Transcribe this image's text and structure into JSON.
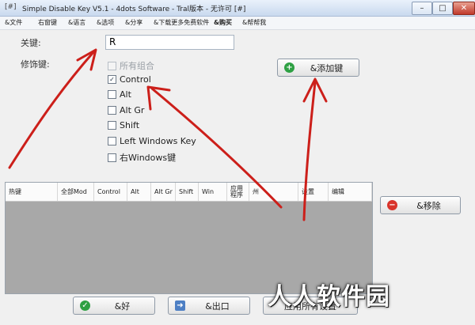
{
  "window": {
    "icon_text": "[#]",
    "title": "Simple Disable Key V5.1 - 4dots Software - Tral版本 - 无许可 [#]",
    "controls": [
      "–",
      "□",
      "✕"
    ]
  },
  "menu": [
    "&文件",
    "右窗键",
    "&语言",
    "&选项",
    "&分享",
    "&下载更多免费软件",
    "&购买",
    "&帮帮我"
  ],
  "form": {
    "key_label": "关键:",
    "key_value": "R",
    "modifier_label": "修饰键:",
    "modifiers": [
      {
        "label": "所有组合",
        "checked": false,
        "disabled": true
      },
      {
        "label": "Control",
        "checked": true,
        "disabled": false
      },
      {
        "label": "Alt",
        "checked": false,
        "disabled": false
      },
      {
        "label": "Alt Gr",
        "checked": false,
        "disabled": false
      },
      {
        "label": "Shift",
        "checked": false,
        "disabled": false
      },
      {
        "label": "Left Windows Key",
        "checked": false,
        "disabled": false
      },
      {
        "label": "右Windows键",
        "checked": false,
        "disabled": false
      }
    ]
  },
  "buttons": {
    "add": "&添加键",
    "remove": "&移除",
    "ok": "&好",
    "exit": "&出口",
    "apply": "应用所有设置"
  },
  "table": {
    "columns": [
      "热键",
      "全部Mod",
      "Control",
      "Alt",
      "Alt Gr",
      "Shift",
      "Win",
      "应用程序",
      "州",
      "设置",
      "编辑"
    ]
  },
  "watermark": "人人软件园",
  "colors": {
    "accent_red": "#cc1f1a",
    "add_icon": "#2ea043",
    "remove_icon": "#d9342b"
  }
}
